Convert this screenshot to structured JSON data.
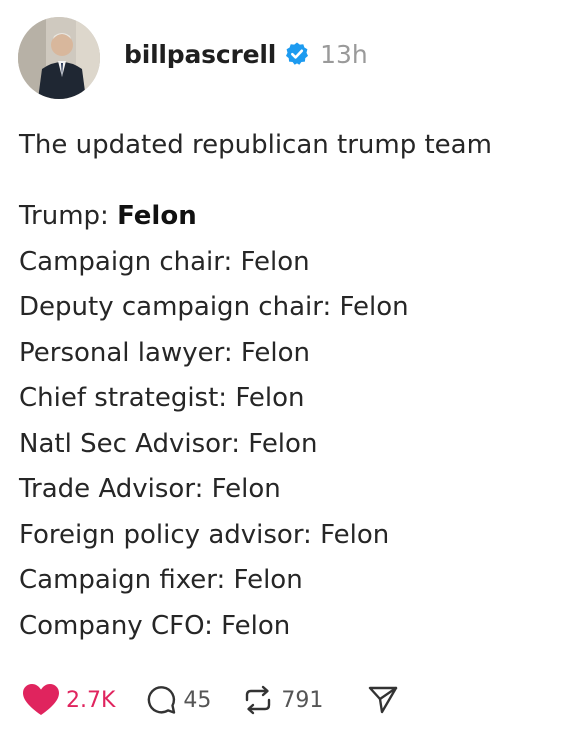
{
  "post": {
    "author": {
      "username": "billpascrell",
      "verified_icon": "verified-badge-icon",
      "time_ago": "13h"
    },
    "headline": "The updated republican trump team",
    "roster": [
      {
        "role": "Trump: ",
        "value": "Felon",
        "bold": true
      },
      {
        "role": "Campaign chair: ",
        "value": "Felon",
        "bold": false
      },
      {
        "role": "Deputy campaign chair: ",
        "value": "Felon",
        "bold": false
      },
      {
        "role": "Personal lawyer: ",
        "value": "Felon",
        "bold": false
      },
      {
        "role": "Chief strategist: ",
        "value": "Felon",
        "bold": false
      },
      {
        "role": "Natl Sec Advisor: ",
        "value": "Felon",
        "bold": false
      },
      {
        "role": "Trade Advisor: ",
        "value": "Felon",
        "bold": false
      },
      {
        "role": "Foreign policy advisor: ",
        "value": "Felon",
        "bold": false
      },
      {
        "role": "Campaign fixer: ",
        "value": "Felon",
        "bold": false
      },
      {
        "role": "Company CFO: ",
        "value": "Felon",
        "bold": false
      }
    ],
    "actions": {
      "likes": {
        "icon": "heart-filled-icon",
        "count": "2.7K"
      },
      "replies": {
        "icon": "comment-bubble-icon",
        "count": "45"
      },
      "reposts": {
        "icon": "repost-icon",
        "count": "791"
      },
      "share": {
        "icon": "send-icon"
      }
    }
  },
  "colors": {
    "like": "#e0245e",
    "verified": "#1d9bf0",
    "muted": "#9a9a9a",
    "text": "#262626"
  }
}
